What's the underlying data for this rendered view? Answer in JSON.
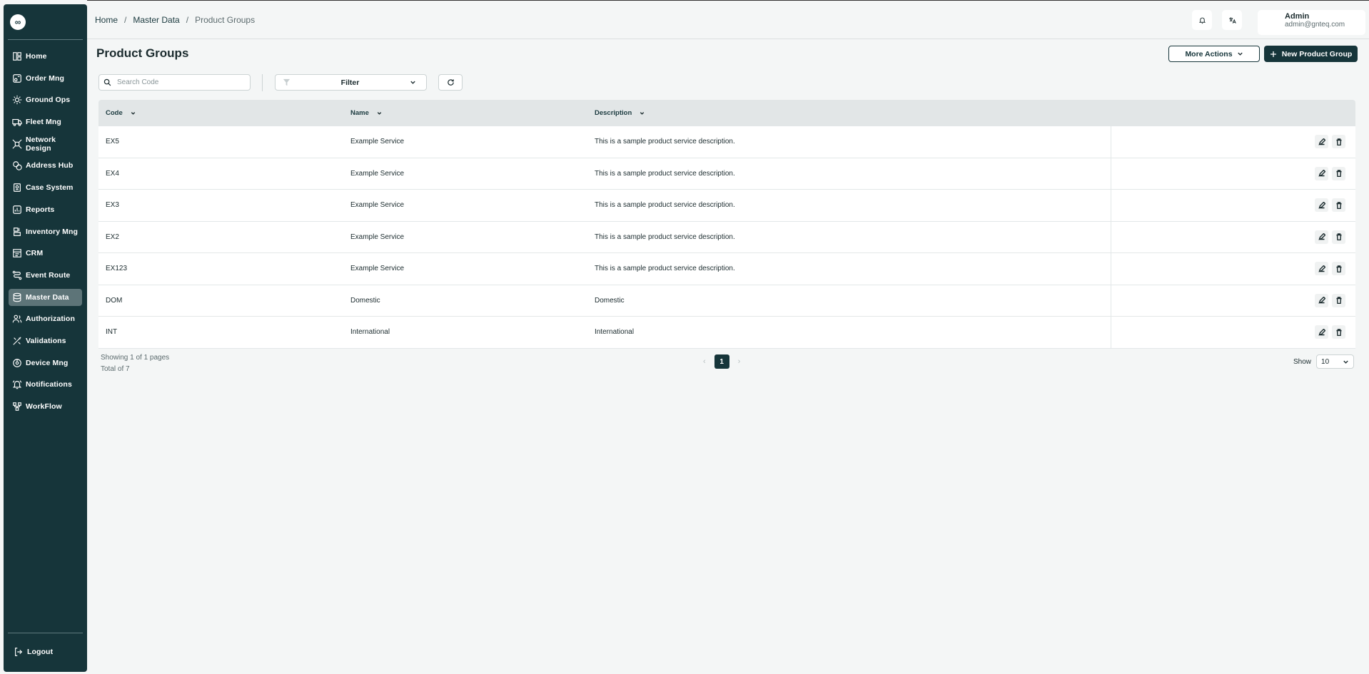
{
  "sidebar": {
    "logo": "∞",
    "items": [
      {
        "label": "Home",
        "icon": "home-icon"
      },
      {
        "label": "Order Mng",
        "icon": "order-icon"
      },
      {
        "label": "Ground Ops",
        "icon": "ground-ops-icon"
      },
      {
        "label": "Fleet Mng",
        "icon": "truck-icon"
      },
      {
        "label": "Network Design",
        "icon": "network-icon"
      },
      {
        "label": "Address Hub",
        "icon": "address-icon"
      },
      {
        "label": "Case System",
        "icon": "case-icon"
      },
      {
        "label": "Reports",
        "icon": "reports-icon"
      },
      {
        "label": "Inventory Mng",
        "icon": "inventory-icon"
      },
      {
        "label": "CRM",
        "icon": "crm-icon"
      },
      {
        "label": "Event Route",
        "icon": "route-icon"
      },
      {
        "label": "Master Data",
        "icon": "database-icon",
        "active": true
      },
      {
        "label": "Authorization",
        "icon": "users-icon"
      },
      {
        "label": "Validations",
        "icon": "validations-icon"
      },
      {
        "label": "Device Mng",
        "icon": "device-icon"
      },
      {
        "label": "Notifications",
        "icon": "bell-icon"
      },
      {
        "label": "WorkFlow",
        "icon": "workflow-icon"
      }
    ],
    "logout": "Logout"
  },
  "breadcrumb": [
    "Home",
    "Master Data",
    "Product Groups"
  ],
  "breadcrumb_sep": "/",
  "user": {
    "name": "Admin",
    "email": "admin@gnteq.com"
  },
  "page": {
    "title": "Product Groups",
    "more_actions": "More Actions",
    "new_button": "New Product Group"
  },
  "toolbar": {
    "search_placeholder": "Search Code",
    "filter_label": "Filter"
  },
  "table": {
    "columns": [
      "Code",
      "Name",
      "Description"
    ],
    "rows": [
      {
        "code": "EX5",
        "name": "Example Service",
        "description": "This is a sample product service description."
      },
      {
        "code": "EX4",
        "name": "Example Service",
        "description": "This is a sample product service description."
      },
      {
        "code": "EX3",
        "name": "Example Service",
        "description": "This is a sample product service description."
      },
      {
        "code": "EX2",
        "name": "Example Service",
        "description": "This is a sample product service description."
      },
      {
        "code": "EX123",
        "name": "Example Service",
        "description": "This is a sample product service description."
      },
      {
        "code": "DOM",
        "name": "Domestic",
        "description": "Domestic"
      },
      {
        "code": "INT",
        "name": "International",
        "description": "International"
      }
    ]
  },
  "pagination": {
    "showing": "Showing 1 of 1 pages",
    "total": "Total of 7",
    "current_page": "1",
    "show_label": "Show",
    "page_size": "10"
  },
  "colors": {
    "sidebar_bg": "#16353a",
    "primary": "#16353a",
    "page_bg": "#f4f6f6",
    "active_item": "#5d7478"
  }
}
